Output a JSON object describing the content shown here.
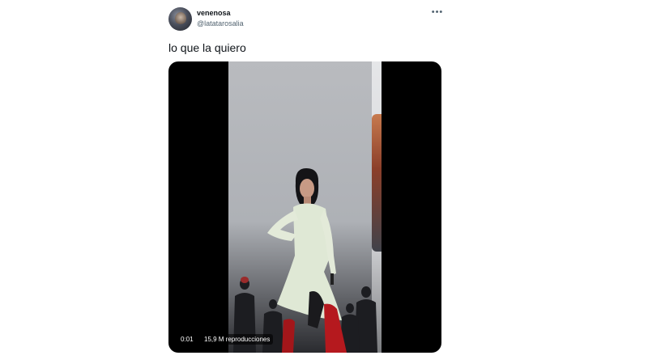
{
  "tweet": {
    "display_name": "venenosa",
    "handle": "@latatarosalia",
    "text": "lo que la quiero",
    "more_icon": "more-icon"
  },
  "video": {
    "elapsed": "0:01",
    "views": "15,9 M reproducciones"
  }
}
